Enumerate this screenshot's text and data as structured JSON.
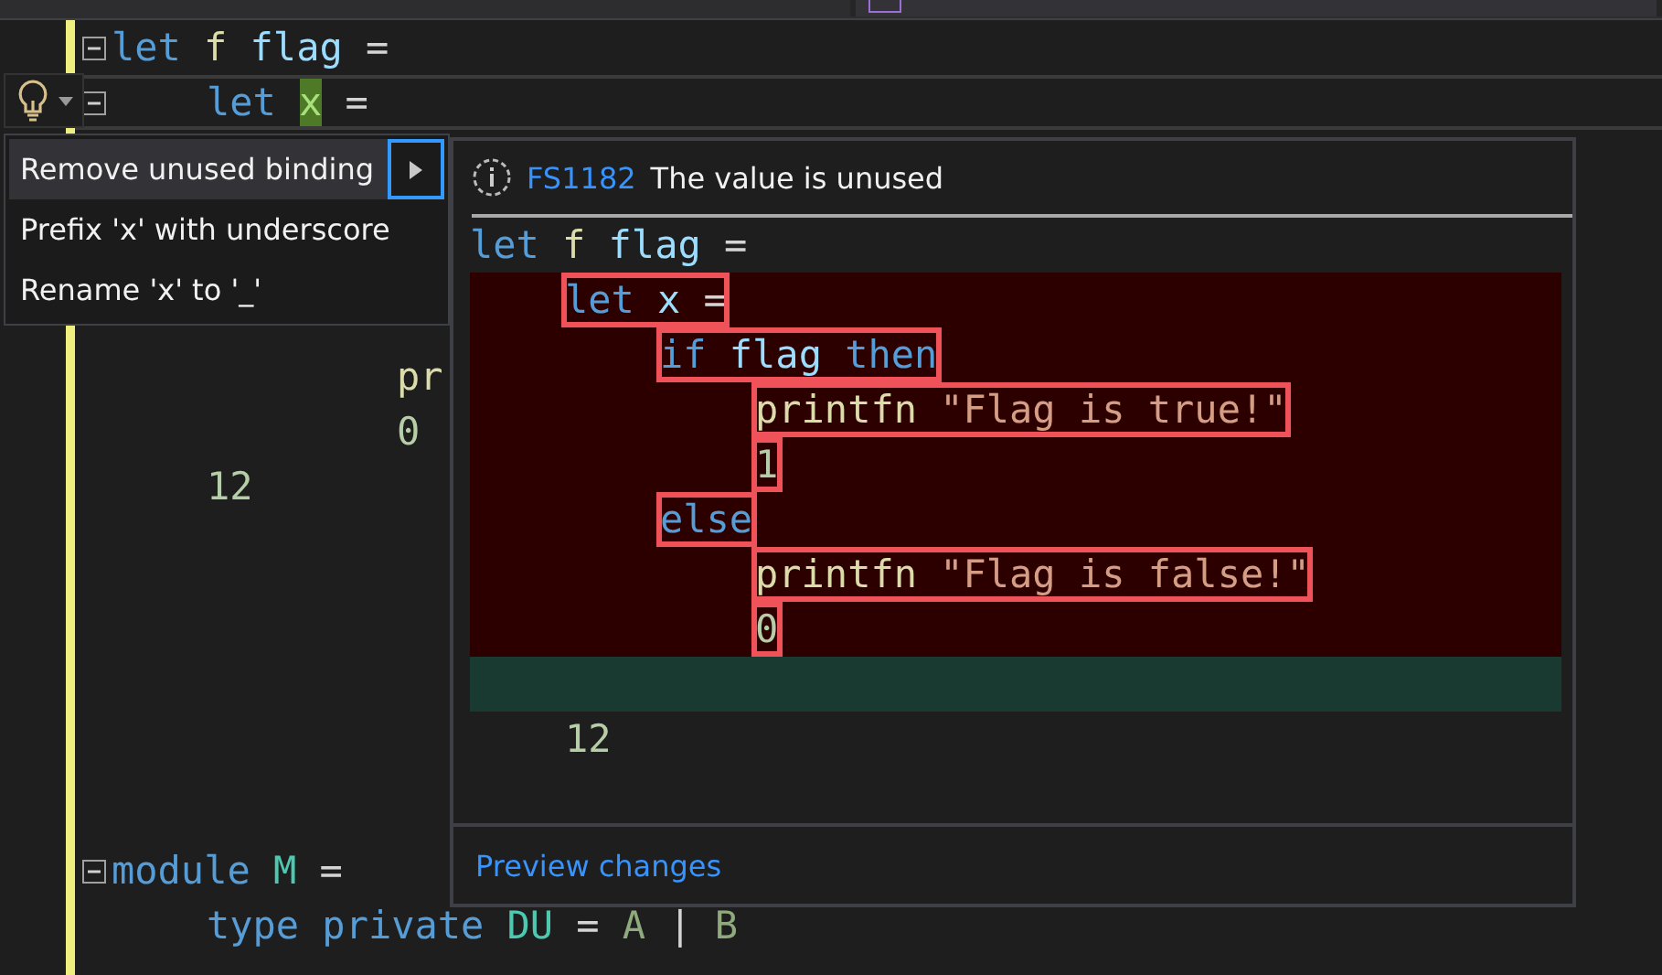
{
  "tabs": [
    {
      "selected": false
    },
    {
      "selected": true
    }
  ],
  "editor": {
    "lines": [
      {
        "kind": "code",
        "foldable": true,
        "tokens": [
          {
            "kind": "keyword",
            "text": "let"
          },
          {
            "kind": "function",
            "text": "f"
          },
          {
            "kind": "variable",
            "text": "flag"
          },
          {
            "kind": "operator",
            "text": "="
          }
        ],
        "children": [
          {
            "kind": "code",
            "foldable": true,
            "current": true,
            "tokens": [
              {
                "kind": "keyword",
                "text": "let"
              },
              {
                "kind": "variable",
                "text": "x",
                "highlighted": true
              },
              {
                "kind": "operator",
                "text": "="
              }
            ],
            "children": [
              {
                "kind": "blank"
              },
              {
                "kind": "blank"
              },
              {
                "kind": "blank"
              },
              {
                "kind": "blank",
                "children": [
                  {
                    "kind": "code",
                    "tokens": [
                      {
                        "kind": "function",
                        "text": "pr"
                      }
                    ]
                  },
                  {
                    "kind": "code",
                    "tokens": [
                      {
                        "kind": "number",
                        "text": "0"
                      }
                    ]
                  }
                ]
              }
            ]
          },
          {
            "kind": "code",
            "tokens": [
              {
                "kind": "number",
                "text": "12"
              }
            ]
          }
        ]
      },
      {
        "kind": "blank"
      },
      {
        "kind": "blank"
      },
      {
        "kind": "blank"
      },
      {
        "kind": "blank"
      },
      {
        "kind": "blank"
      },
      {
        "kind": "blank"
      },
      {
        "kind": "code",
        "foldable": true,
        "tokens": [
          {
            "kind": "keyword",
            "text": "module"
          },
          {
            "kind": "type",
            "text": "M"
          },
          {
            "kind": "operator",
            "text": "="
          }
        ],
        "children": [
          {
            "kind": "code",
            "tokens": [
              {
                "kind": "keyword",
                "text": "type"
              },
              {
                "kind": "keyword",
                "text": "private"
              },
              {
                "kind": "type",
                "text": "DU"
              },
              {
                "kind": "operator",
                "text": "="
              },
              {
                "kind": "member",
                "text": "A"
              },
              {
                "kind": "operator",
                "text": "|"
              },
              {
                "kind": "member",
                "text": "B"
              }
            ]
          }
        ]
      }
    ]
  },
  "quick_actions": {
    "items": [
      {
        "label": "Remove unused binding",
        "selected": true,
        "submenu": true
      },
      {
        "label": "Prefix 'x' with underscore",
        "selected": false,
        "submenu": false
      },
      {
        "label": "Rename 'x' to '_'",
        "selected": false,
        "submenu": false
      }
    ]
  },
  "preview": {
    "code": "FS1182",
    "message": "The value is unused",
    "lines": [
      {
        "kind": "code",
        "removed": false,
        "added": false,
        "tokens": [
          {
            "kind": "keyword",
            "text": "let"
          },
          {
            "kind": "function",
            "text": "f"
          },
          {
            "kind": "variable",
            "text": "flag"
          },
          {
            "kind": "operator",
            "text": "="
          }
        ],
        "children": [
          {
            "kind": "code",
            "removed": true,
            "added": false,
            "tokens": [
              {
                "kind": "keyword",
                "text": "let"
              },
              {
                "kind": "variable",
                "text": "x"
              },
              {
                "kind": "operator",
                "text": "="
              }
            ],
            "children": [
              {
                "kind": "code",
                "removed": true,
                "added": false,
                "tokens": [
                  {
                    "kind": "keyword",
                    "text": "if"
                  },
                  {
                    "kind": "variable",
                    "text": "flag"
                  },
                  {
                    "kind": "keyword",
                    "text": "then"
                  }
                ],
                "children": [
                  {
                    "kind": "code",
                    "removed": true,
                    "added": false,
                    "tokens": [
                      {
                        "kind": "function",
                        "text": "printfn"
                      },
                      {
                        "kind": "string",
                        "text": "\"Flag is true!\""
                      }
                    ]
                  },
                  {
                    "kind": "code",
                    "removed": true,
                    "added": false,
                    "tokens": [
                      {
                        "kind": "number",
                        "text": "1"
                      }
                    ]
                  }
                ]
              },
              {
                "kind": "code",
                "removed": true,
                "added": false,
                "tokens": [
                  {
                    "kind": "keyword",
                    "text": "else"
                  }
                ],
                "children": [
                  {
                    "kind": "code",
                    "removed": true,
                    "added": false,
                    "tokens": [
                      {
                        "kind": "function",
                        "text": "printfn"
                      },
                      {
                        "kind": "string",
                        "text": "\"Flag is false!\""
                      }
                    ]
                  },
                  {
                    "kind": "code",
                    "removed": true,
                    "added": false,
                    "tokens": [
                      {
                        "kind": "number",
                        "text": "0"
                      }
                    ]
                  }
                ]
              }
            ]
          },
          {
            "kind": "blank",
            "removed": false,
            "added": true
          },
          {
            "kind": "code",
            "removed": false,
            "added": false,
            "tokens": [
              {
                "kind": "number",
                "text": "12"
              }
            ]
          }
        ]
      }
    ],
    "link": "Preview changes"
  }
}
